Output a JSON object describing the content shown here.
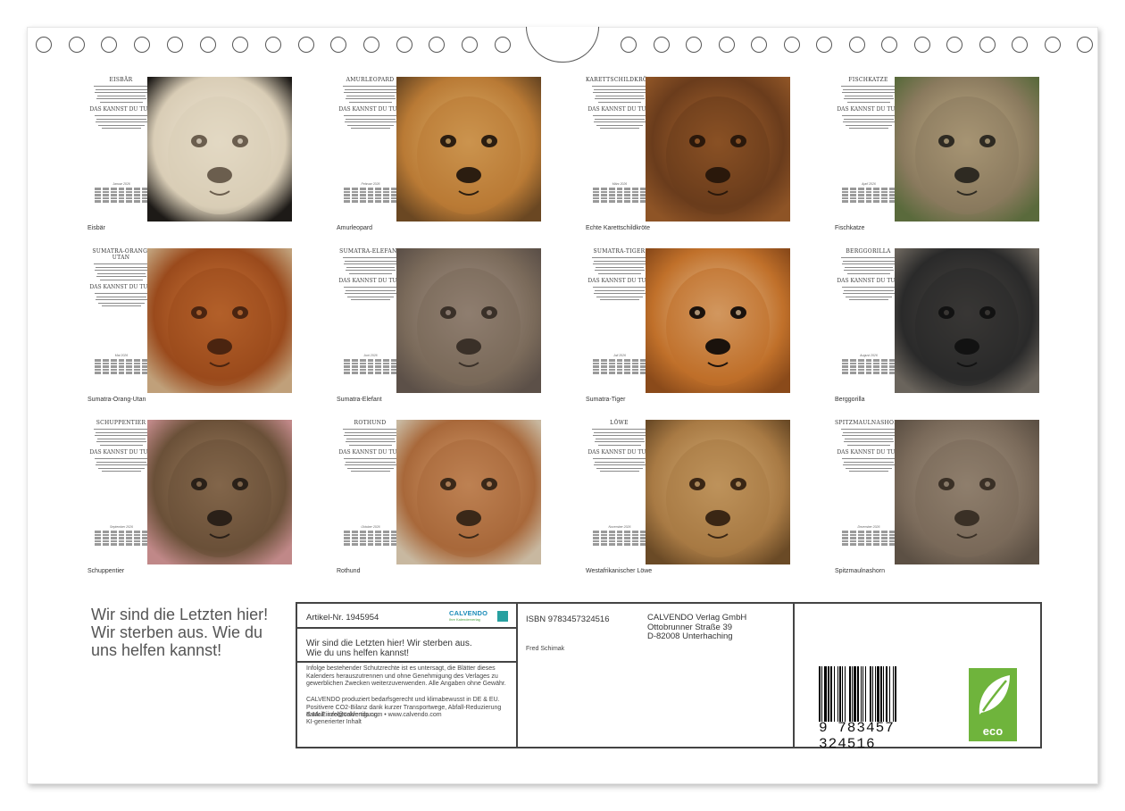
{
  "cells": [
    {
      "title": "EISBÄR",
      "subtitle": "DAS KANNST DU TUN",
      "caption": "Eisbär",
      "month": "Januar 2026",
      "colors": [
        "#d9cdb6",
        "#efe6d4",
        "#6b5e4e",
        "#1d1a17"
      ]
    },
    {
      "title": "AMURLEOPARD",
      "subtitle": "DAS KANNST DU TUN",
      "caption": "Amurleopard",
      "month": "Februar 2026",
      "colors": [
        "#b97a35",
        "#e0b36d",
        "#2b1d10",
        "#6a4722"
      ]
    },
    {
      "title": "KARETTSCHILDKRÖTE",
      "subtitle": "DAS KANNST DU TUN",
      "caption": "Echte Karettschildkröte",
      "month": "März 2026",
      "colors": [
        "#6a3c1c",
        "#b06a30",
        "#2a180b",
        "#8e5426"
      ]
    },
    {
      "title": "FISCHKATZE",
      "subtitle": "DAS KANNST DU TUN",
      "caption": "Fischkatze",
      "month": "April 2026",
      "colors": [
        "#8a7a5e",
        "#c8b48c",
        "#2e2a22",
        "#5a6a3c"
      ]
    },
    {
      "title": "SUMATRA-ORANG-UTAN",
      "subtitle": "DAS KANNST DU TUN",
      "caption": "Sumatra-Orang-Utan",
      "month": "Mai 2026",
      "colors": [
        "#9a4a1c",
        "#d07a3c",
        "#4a2410",
        "#c0a07a"
      ]
    },
    {
      "title": "SUMATRA-ELEFANT",
      "subtitle": "DAS KANNST DU TUN",
      "caption": "Sumatra-Elefant",
      "month": "Juni 2026",
      "colors": [
        "#7a6a5a",
        "#a8968a",
        "#3a3028",
        "#5c5048"
      ]
    },
    {
      "title": "SUMATRA-TIGER",
      "subtitle": "DAS KANNST DU TUN",
      "caption": "Sumatra-Tiger",
      "month": "Juli 2026",
      "colors": [
        "#c0702a",
        "#e8c8a0",
        "#1a120c",
        "#8a4a1a"
      ]
    },
    {
      "title": "BERGGORILLA",
      "subtitle": "DAS KANNST DU TUN",
      "caption": "Berggorilla",
      "month": "August 2026",
      "colors": [
        "#2a2a2a",
        "#4a4642",
        "#121212",
        "#6a645c"
      ]
    },
    {
      "title": "SCHUPPENTIER",
      "subtitle": "DAS KANNST DU TUN",
      "caption": "Schuppentier",
      "month": "September 2026",
      "colors": [
        "#6a5038",
        "#a08060",
        "#2a2018",
        "#c08888"
      ]
    },
    {
      "title": "ROTHUND",
      "subtitle": "DAS KANNST DU TUN",
      "caption": "Rothund",
      "month": "Oktober 2026",
      "colors": [
        "#a8683a",
        "#d8a070",
        "#3a2818",
        "#c8b8a0"
      ]
    },
    {
      "title": "LÖWE",
      "subtitle": "DAS KANNST DU TUN",
      "caption": "Westafrikanischer Löwe",
      "month": "November 2026",
      "colors": [
        "#a87a44",
        "#d8b078",
        "#3a2614",
        "#6a4a26"
      ]
    },
    {
      "title": "SPITZMAULNASHORN",
      "subtitle": "DAS KANNST DU TUN",
      "caption": "Spitzmaulnashorn",
      "month": "Dezember 2026",
      "colors": [
        "#7a6a5a",
        "#a89884",
        "#3a3026",
        "#5c5044"
      ]
    }
  ],
  "cover_title": "Wir sind die Letzten hier! Wir sterben aus. Wie du uns helfen kannst!",
  "info": {
    "article": "Artikel-Nr. 1945954",
    "brand": "CALVENDO",
    "brand_sub": "Ihre Kalenderverlag",
    "title": "Wir sind die Letzten hier! Wir sterben aus. Wie du uns helfen kannst!",
    "legal": "Infolge bestehender Schutzrechte ist es untersagt, die Blätter dieses Kalenders herauszutrennen und ohne Genehmigung des Verlages zu gewerblichen Zwecken weiterzuverwenden. Alle Angaben ohne Gewähr.",
    "eco_text": "CALVENDO produziert bedarfsgerecht und klimabewusst in DE & EU. Positivere CO2-Bilanz dank kurzer Transportwege, Abfall-Reduzierung dank Einzelstückfertigung.",
    "contact": "E-Mail: info@calvendo.com • www.calvendo.com",
    "ai_note": "KI-generierter Inhalt",
    "isbn": "ISBN 9783457324516",
    "author": "Fred Schimak",
    "publisher": "CALVENDO Verlag GmbH",
    "street": "Ottobrunner Straße 39",
    "city": "D-82008 Unterhaching",
    "barcode_number": "9 783457 324516",
    "eco_label": "eco"
  }
}
